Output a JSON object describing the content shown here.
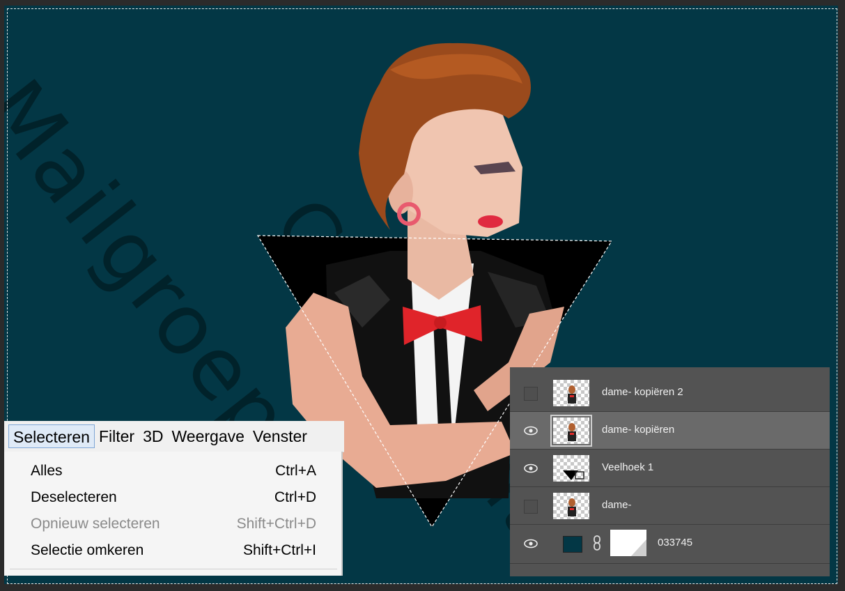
{
  "watermark": {
    "text1": "Mailgroep",
    "text2": "Copyright"
  },
  "menu": {
    "bar": [
      "Selecteren",
      "Filter",
      "3D",
      "Weergave",
      "Venster"
    ],
    "items": [
      {
        "label": "Alles",
        "shortcut": "Ctrl+A",
        "enabled": true
      },
      {
        "label": "Deselecteren",
        "shortcut": "Ctrl+D",
        "enabled": true
      },
      {
        "label": "Opnieuw selecteren",
        "shortcut": "Shift+Ctrl+D",
        "enabled": false
      },
      {
        "label": "Selectie omkeren",
        "shortcut": "Shift+Ctrl+I",
        "enabled": true
      }
    ]
  },
  "layers": [
    {
      "name": "dame- kopiëren 2",
      "visible": false,
      "selected": false,
      "thumb": "portrait"
    },
    {
      "name": "dame- kopiëren",
      "visible": true,
      "selected": true,
      "thumb": "portrait"
    },
    {
      "name": "Veelhoek 1",
      "visible": true,
      "selected": false,
      "thumb": "triangle-shape"
    },
    {
      "name": "dame-",
      "visible": false,
      "selected": false,
      "thumb": "portrait"
    },
    {
      "name": "033745",
      "visible": true,
      "selected": false,
      "thumb": "color-fill"
    }
  ],
  "colors": {
    "canvas": "#033745",
    "panel": "#535353",
    "menu": "#f0f0f0"
  }
}
